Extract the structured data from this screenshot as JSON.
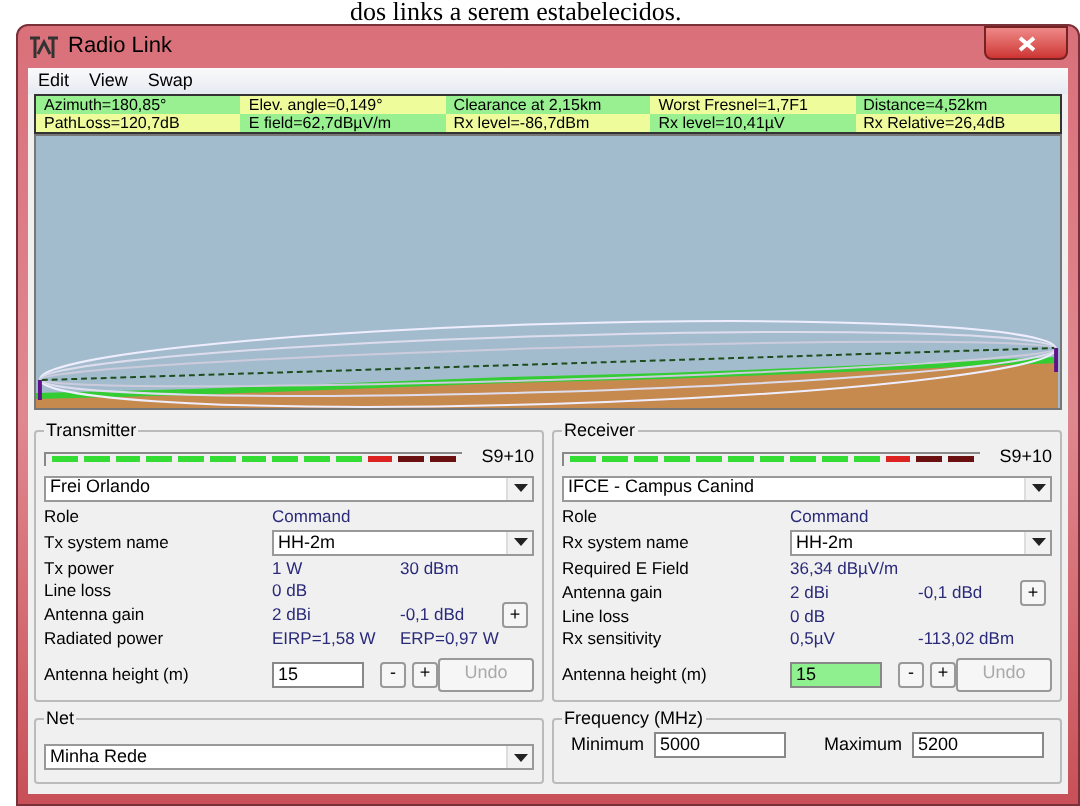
{
  "document_text": "dos links a serem estabelecidos.",
  "window": {
    "title": "Radio Link"
  },
  "menu": [
    "Edit",
    "View",
    "Swap"
  ],
  "summary": [
    [
      "Azimuth=180,85°",
      "Elev. angle=0,149°",
      "Clearance at 2,15km",
      "Worst Fresnel=1,7F1",
      "Distance=4,52km"
    ],
    [
      "PathLoss=120,7dB",
      "E field=62,7dBµV/m",
      "Rx level=-86,7dBm",
      "Rx level=10,41µV",
      "Rx Relative=26,4dB"
    ]
  ],
  "transmitter": {
    "title": "Transmitter",
    "meter": {
      "level": 0.85,
      "reading": "S9+10"
    },
    "unit": "Frei Orlando",
    "rows": [
      {
        "kind": "text",
        "label": "Role",
        "value": "Command"
      },
      {
        "kind": "select",
        "label": "Tx system name",
        "value": "HH-2m"
      },
      {
        "kind": "text",
        "label": "Tx power",
        "value": "1 W",
        "value2": "30 dBm"
      },
      {
        "kind": "text",
        "label": "Line loss",
        "value": "0 dB"
      },
      {
        "kind": "text",
        "label": "Antenna gain",
        "value": "2 dBi",
        "value2": "-0,1 dBd",
        "button": "+"
      },
      {
        "kind": "text",
        "label": "Radiated power",
        "value": "EIRP=1,58 W",
        "value2": "ERP=0,97 W"
      }
    ],
    "height": {
      "label": "Antenna height (m)",
      "value": "15",
      "highlighted": false,
      "minus": "-",
      "plus": "+",
      "undo": {
        "label": "Undo",
        "disabled": true
      }
    }
  },
  "receiver": {
    "title": "Receiver",
    "meter": {
      "level": 0.85,
      "reading": "S9+10"
    },
    "unit": "IFCE - Campus Canind",
    "rows": [
      {
        "kind": "text",
        "label": "Role",
        "value": "Command"
      },
      {
        "kind": "select",
        "label": "Rx system name",
        "value": "HH-2m"
      },
      {
        "kind": "text",
        "label": "Required E Field",
        "value": "36,34 dBµV/m"
      },
      {
        "kind": "text",
        "label": "Antenna gain",
        "value": "2 dBi",
        "value2": "-0,1 dBd",
        "button": "+"
      },
      {
        "kind": "text",
        "label": "Line loss",
        "value": "0 dB"
      },
      {
        "kind": "text",
        "label": "Rx sensitivity",
        "value": "0,5µV",
        "value2": "-113,02 dBm"
      }
    ],
    "height": {
      "label": "Antenna height (m)",
      "value": "15",
      "highlighted": true,
      "minus": "-",
      "plus": "+",
      "undo": {
        "label": "Undo",
        "disabled": true
      }
    }
  },
  "net": {
    "title": "Net",
    "value": "Minha Rede"
  },
  "frequency": {
    "title": "Frequency (MHz)",
    "minimum_label": "Minimum",
    "minimum": "5000",
    "maximum_label": "Maximum",
    "maximum": "5200"
  }
}
